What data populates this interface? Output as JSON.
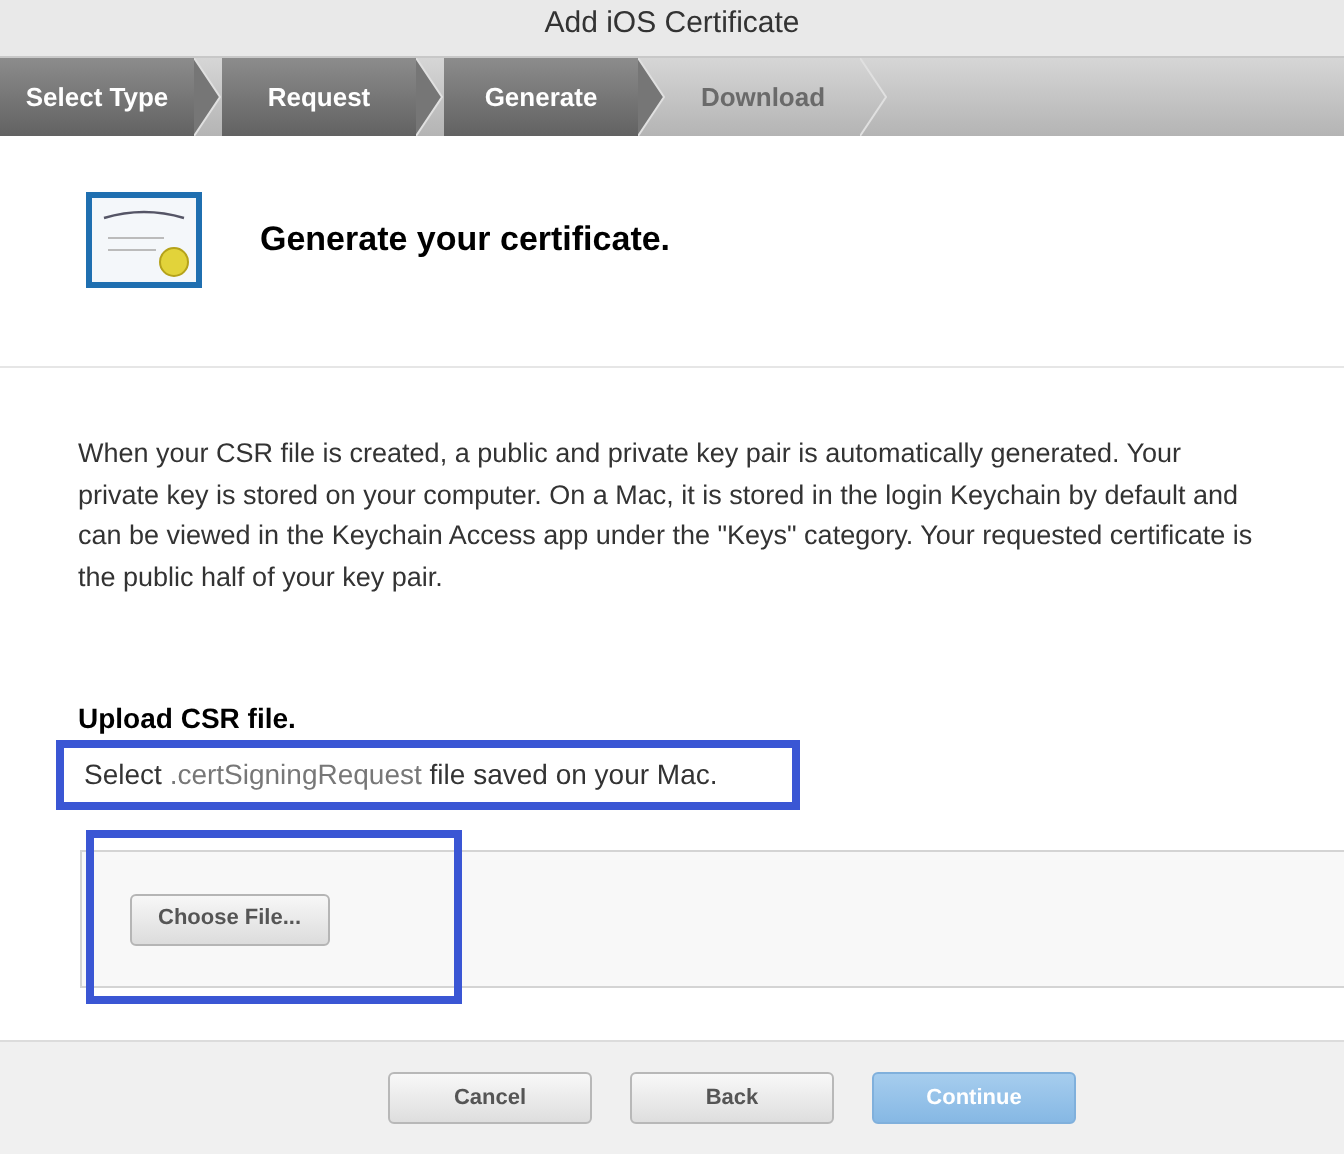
{
  "window": {
    "title": "Add iOS Certificate"
  },
  "steps": [
    {
      "label": "Select Type",
      "completed": true
    },
    {
      "label": "Request",
      "completed": true
    },
    {
      "label": "Generate",
      "completed": true
    },
    {
      "label": "Download",
      "completed": false
    }
  ],
  "heading": "Generate your certificate.",
  "description": "When your CSR file is created, a public and private key pair is automatically generated. Your private key is stored on your computer. On a Mac, it is stored in the login Keychain by default and can be viewed in the Keychain Access app under the \"Keys\" category. Your requested certificate is the public half of your key pair.",
  "upload": {
    "title": "Upload CSR file.",
    "instruction": [
      "Select ",
      ".certSigningRequest",
      " file saved on your Mac."
    ],
    "choose_button": "Choose File...",
    "highlighted": true
  },
  "buttons": [
    {
      "label": "Cancel",
      "disabled": false
    },
    {
      "label": "Back",
      "disabled": false
    },
    {
      "label": "Continue",
      "disabled": true
    }
  ]
}
